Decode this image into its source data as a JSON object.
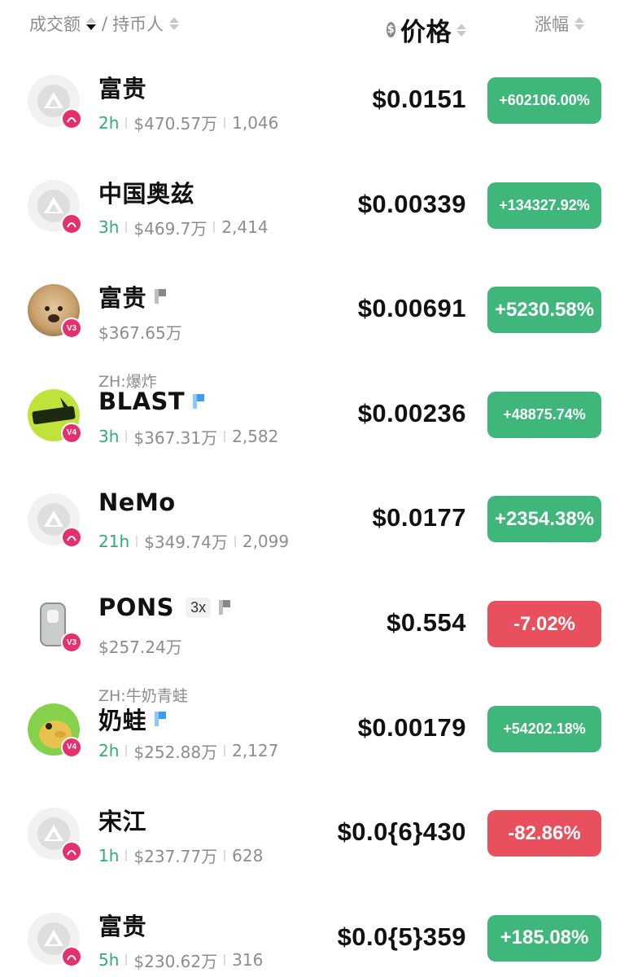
{
  "header": {
    "volume_label": "成交额",
    "slash": "/",
    "holders_label": "持币人",
    "coin_icon": "$",
    "price_label": "价格",
    "change_label": "涨幅"
  },
  "rows": [
    {
      "name": "富贵",
      "tag": "",
      "leverage": "",
      "flag": "",
      "avatar": "default-logo",
      "badge": "",
      "age": "2h",
      "volume": "$470.57万",
      "holders": "1,046",
      "price": "$0.0151",
      "change": "+602106.00%",
      "direction": "up"
    },
    {
      "name": "中国奥兹",
      "tag": "",
      "leverage": "",
      "flag": "",
      "avatar": "default-logo",
      "badge": "",
      "age": "3h",
      "volume": "$469.7万",
      "holders": "2,414",
      "price": "$0.00339",
      "change": "+134327.92%",
      "direction": "up"
    },
    {
      "name": "富贵",
      "tag": "",
      "leverage": "",
      "flag": "gray",
      "avatar": "dog-photo",
      "badge": "V3",
      "age": "",
      "volume": "$367.65万",
      "holders": "",
      "price": "$0.00691",
      "change": "+5230.58%",
      "direction": "up"
    },
    {
      "name": "BLAST",
      "tag": "ZH:爆炸",
      "leverage": "",
      "flag": "blue",
      "avatar": "blast-logo",
      "badge": "V4",
      "age": "3h",
      "volume": "$367.31万",
      "holders": "2,582",
      "price": "$0.00236",
      "change": "+48875.74%",
      "direction": "up"
    },
    {
      "name": "NeMo",
      "tag": "",
      "leverage": "",
      "flag": "",
      "avatar": "default-logo",
      "badge": "",
      "age": "21h",
      "volume": "$349.74万",
      "holders": "2,099",
      "price": "$0.0177",
      "change": "+2354.38%",
      "direction": "up"
    },
    {
      "name": "PONS",
      "tag": "",
      "leverage": "3x",
      "flag": "gray",
      "avatar": "pons-logo",
      "badge": "V3",
      "age": "",
      "volume": "$257.24万",
      "holders": "",
      "price": "$0.554",
      "change": "-7.02%",
      "direction": "down"
    },
    {
      "name": "奶蛙",
      "tag": "ZH:牛奶青蛙",
      "leverage": "",
      "flag": "blue",
      "avatar": "frog-photo",
      "badge": "V4",
      "age": "2h",
      "volume": "$252.88万",
      "holders": "2,127",
      "price": "$0.00179",
      "change": "+54202.18%",
      "direction": "up"
    },
    {
      "name": "宋江",
      "tag": "",
      "leverage": "",
      "flag": "",
      "avatar": "default-logo",
      "badge": "",
      "age": "1h",
      "volume": "$237.77万",
      "holders": "628",
      "price": "$0.0{6}430",
      "change": "-82.86%",
      "direction": "down"
    },
    {
      "name": "富贵",
      "tag": "",
      "leverage": "",
      "flag": "",
      "avatar": "default-logo",
      "badge": "",
      "age": "5h",
      "volume": "$230.62万",
      "holders": "316",
      "price": "$0.0{5}359",
      "change": "+185.08%",
      "direction": "up"
    }
  ],
  "colors": {
    "up": "#3fb67a",
    "down": "#e8505e",
    "age": "#2fae73",
    "badge": "#e5306e"
  }
}
